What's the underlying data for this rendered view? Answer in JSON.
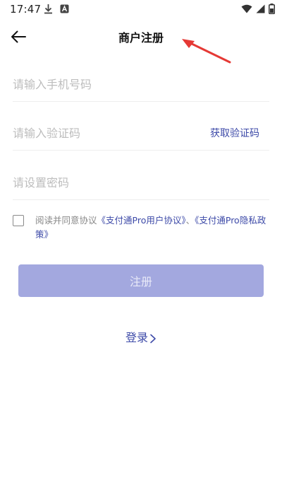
{
  "status_bar": {
    "time": "17:47",
    "icons_left": [
      "download-icon",
      "app-notification-icon"
    ],
    "icons_right": [
      "wifi-icon",
      "cellular-signal-icon",
      "battery-icon"
    ]
  },
  "header": {
    "title": "商户注册",
    "back_icon": "arrow-left-icon"
  },
  "form": {
    "phone_placeholder": "请输入手机号码",
    "phone_value": "",
    "code_placeholder": "请输入验证码",
    "code_value": "",
    "get_code_label": "获取验证码",
    "password_placeholder": "请设置密码",
    "password_value": ""
  },
  "agreement": {
    "checked": false,
    "prefix": "阅读并同意协议",
    "link1": "《支付通Pro用户协议》",
    "separator": "、",
    "link2": "《支付通Pro隐私政策》"
  },
  "register_label": "注册",
  "login_label": "登录",
  "colors": {
    "accent": "#3d4aa8",
    "button_disabled": "#a3a8df",
    "placeholder": "#bdbdbd",
    "annotation_arrow": "#e53935"
  }
}
